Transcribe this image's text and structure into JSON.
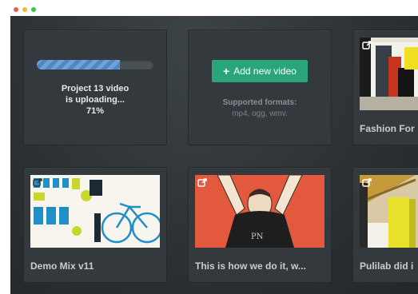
{
  "window": {
    "controls": [
      "close",
      "minimize",
      "maximize"
    ]
  },
  "upload_card": {
    "status_line1": "Project 13 video",
    "status_line2": "is uploading...",
    "progress_text": "71%",
    "progress_fraction": 0.71
  },
  "add_card": {
    "button_label": "Add new video",
    "button_icon": "plus-icon",
    "formats_label": "Supported formats:",
    "formats_values": "mp4, ogg, wmv."
  },
  "videos": [
    {
      "title": "Fashion For",
      "icon": "share-icon"
    },
    {
      "title": "Demo Mix v11",
      "icon": "share-icon"
    },
    {
      "title": "This is how we do it, w...",
      "icon": "share-icon"
    },
    {
      "title": "Pulilab did i",
      "icon": "share-icon"
    }
  ],
  "colors": {
    "accent_green": "#2aa57a",
    "progress_blue": "#6fa2d8",
    "background": "#2c3235",
    "card": "#33393d"
  }
}
